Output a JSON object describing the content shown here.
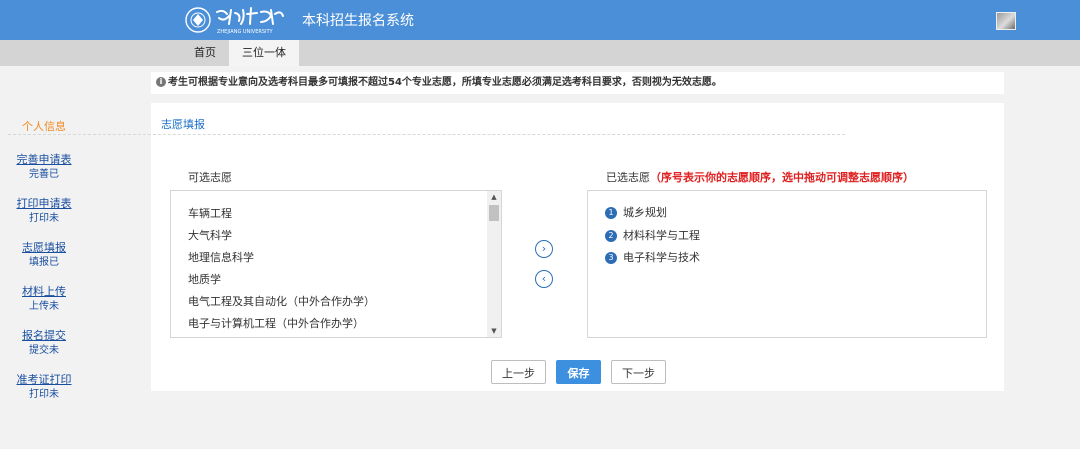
{
  "header": {
    "system_title": "本科招生报名系统",
    "logo_text": "浙江大学",
    "logo_subtext": "ZHEJIANG UNIVERSITY"
  },
  "tabs": [
    "首页",
    "三位一体"
  ],
  "sidebar": {
    "heading": "个人信息",
    "items": [
      {
        "label": "完善申请表",
        "status": "完善已"
      },
      {
        "label": "打印申请表",
        "status": "打印未"
      },
      {
        "label": "志愿填报",
        "status": "填报已"
      },
      {
        "label": "材料上传",
        "status": "上传未"
      },
      {
        "label": "报名提交",
        "status": "提交未"
      },
      {
        "label": "准考证打印",
        "status": "打印未"
      }
    ]
  },
  "notice": "考生可根据专业意向及选考科目最多可填报不超过54个专业志愿，所填专业志愿必须满足选考科目要求，否则视为无效志愿。",
  "panel": {
    "title": "志愿填报",
    "available_label": "可选志愿",
    "selected_label": "已选志愿",
    "selected_hint": "（序号表示你的志愿顺序，选中拖动可调整志愿顺序）",
    "available": [
      "车辆工程",
      "大气科学",
      "地理信息科学",
      "地质学",
      "电气工程及其自动化（中外合作办学）",
      "电子与计算机工程（中外合作办学）"
    ],
    "selected": [
      {
        "num": "1",
        "name": "城乡规划"
      },
      {
        "num": "2",
        "name": "材料科学与工程"
      },
      {
        "num": "3",
        "name": "电子科学与技术"
      }
    ]
  },
  "buttons": {
    "prev": "上一步",
    "save": "保存",
    "next": "下一步"
  },
  "icons": {
    "info": "info-icon",
    "add": "chevron-right-icon",
    "remove": "chevron-left-icon"
  },
  "colors": {
    "header_bg": "#4a8fd8",
    "primary_button": "#3d8fe0",
    "sidebar_heading": "#f08a24",
    "hint": "#e02020"
  }
}
